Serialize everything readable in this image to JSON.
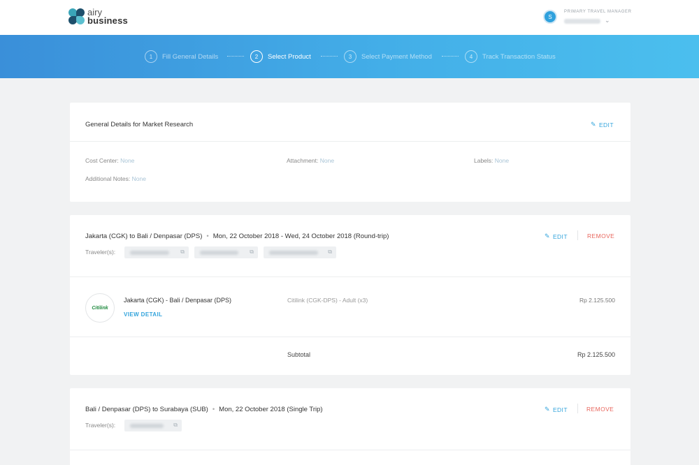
{
  "header": {
    "logo": {
      "line1": "airy",
      "line2": "business"
    },
    "user": {
      "avatar_initial": "S",
      "role": "PRIMARY TRAVEL MANAGER"
    }
  },
  "steps": [
    {
      "number": "1",
      "label": "Fill General Details",
      "active": false
    },
    {
      "number": "2",
      "label": "Select Product",
      "active": true
    },
    {
      "number": "3",
      "label": "Select Payment Method",
      "active": false
    },
    {
      "number": "4",
      "label": "Track Transaction Status",
      "active": false
    }
  ],
  "general": {
    "title": "General Details for Market Research",
    "edit_label": "EDIT",
    "cost_center_label": "Cost Center:",
    "cost_center_value": "None",
    "attachment_label": "Attachment:",
    "attachment_value": "None",
    "labels_label": "Labels:",
    "labels_value": "None",
    "notes_label": "Additional Notes:",
    "notes_value": "None"
  },
  "trip1": {
    "route": "Jakarta (CGK) to Bali / Denpasar (DPS)",
    "dates": "Mon, 22 October 2018 - Wed, 24 October 2018 (Round-trip)",
    "edit_label": "EDIT",
    "remove_label": "REMOVE",
    "travelers_label": "Traveler(s):",
    "flight": {
      "airline": "Citilink",
      "route": "Jakarta (CGK) - Bali / Denpasar (DPS)",
      "view_detail": "VIEW DETAIL",
      "info": "Citilink (CGK-DPS) - Adult (x3)",
      "price": "Rp 2.125.500"
    },
    "subtotal_label": "Subtotal",
    "subtotal_value": "Rp 2.125.500"
  },
  "trip2": {
    "route": "Bali / Denpasar (DPS) to Surabaya (SUB)",
    "dates": "Mon, 22 October 2018 (Single Trip)",
    "edit_label": "EDIT",
    "remove_label": "REMOVE",
    "travelers_label": "Traveler(s):"
  },
  "icons": {
    "edit": "pencil-icon",
    "external": "external-link-icon",
    "chevron": "chevron-down-icon"
  }
}
